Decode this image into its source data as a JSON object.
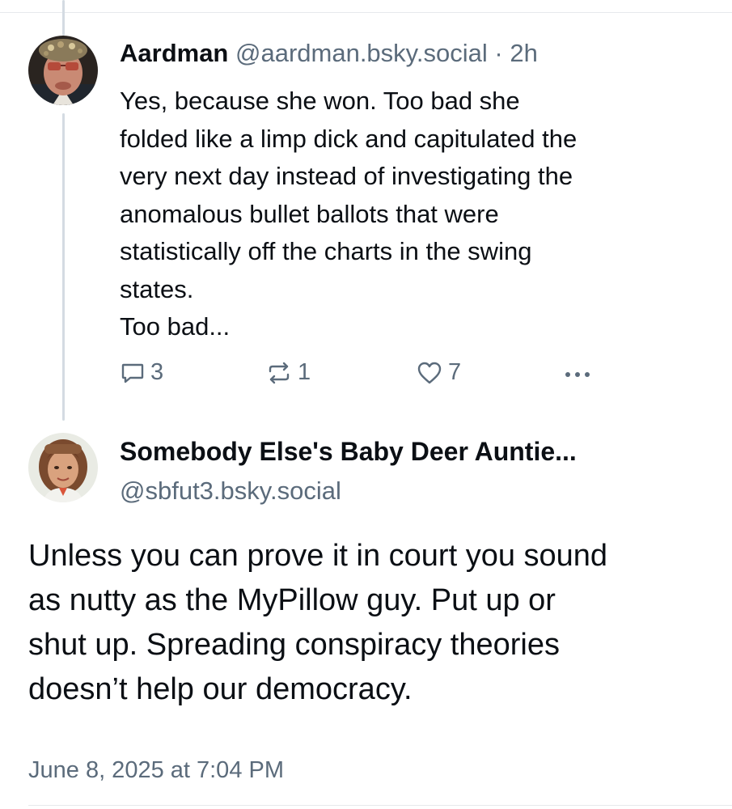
{
  "parent_post": {
    "author_name": "Aardman",
    "author_handle": "@aardman.bsky.social",
    "separator": "·",
    "age": "2h",
    "text_lines": [
      "Yes, because she won. Too bad she",
      "folded like a limp dick and capitulated the",
      "very next day instead of investigating the",
      "anomalous bullet ballots that were",
      "statistically off the charts in the swing",
      "states.",
      "Too bad..."
    ],
    "replies": "3",
    "reposts": "1",
    "likes": "7",
    "icons": {
      "reply": "reply-bubble-icon",
      "repost": "repost-arrows-icon",
      "like": "heart-outline-icon",
      "more": "ellipsis-icon"
    }
  },
  "main_post": {
    "author_name": "Somebody Else's Baby Deer Auntie...",
    "author_handle": "@sbfut3.bsky.social",
    "text_lines": [
      "Unless you can prove it in court you sound",
      "as nutty as the MyPillow guy. Put up or",
      "shut up. Spreading conspiracy theories",
      "doesn’t help our democracy."
    ],
    "timestamp": "June 8, 2025 at 7:04 PM"
  },
  "colors": {
    "text_primary": "#0b0f14",
    "text_secondary": "#5b6b7b",
    "thread_line": "#d4dbe2",
    "divider": "#e6e9ec"
  }
}
